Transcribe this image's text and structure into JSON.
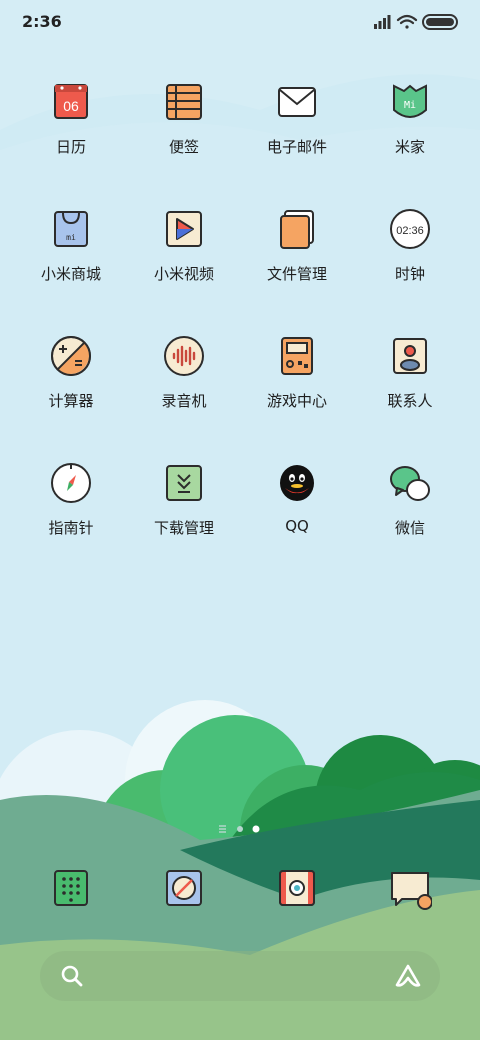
{
  "status": {
    "time": "2:36"
  },
  "apps": [
    {
      "label": "日历",
      "icon": "calendar-icon",
      "date": "06"
    },
    {
      "label": "便签",
      "icon": "notes-icon"
    },
    {
      "label": "电子邮件",
      "icon": "mail-icon"
    },
    {
      "label": "米家",
      "icon": "mijia-icon",
      "logo": "Mi"
    },
    {
      "label": "小米商城",
      "icon": "mi-store-icon",
      "logo": "mi"
    },
    {
      "label": "小米视频",
      "icon": "video-icon"
    },
    {
      "label": "文件管理",
      "icon": "file-manager-icon"
    },
    {
      "label": "时钟",
      "icon": "clock-icon",
      "time": "02:36"
    },
    {
      "label": "计算器",
      "icon": "calculator-icon"
    },
    {
      "label": "录音机",
      "icon": "recorder-icon"
    },
    {
      "label": "游戏中心",
      "icon": "game-center-icon"
    },
    {
      "label": "联系人",
      "icon": "contacts-icon"
    },
    {
      "label": "指南针",
      "icon": "compass-icon"
    },
    {
      "label": "下载管理",
      "icon": "download-icon"
    },
    {
      "label": "QQ",
      "icon": "qq-icon"
    },
    {
      "label": "微信",
      "icon": "wechat-icon"
    }
  ],
  "dock": [
    {
      "icon": "phone-dialer-icon"
    },
    {
      "icon": "browser-icon"
    },
    {
      "icon": "camera-icon"
    },
    {
      "icon": "messages-icon"
    }
  ],
  "page_indicator": {
    "pages": 3,
    "current": 3
  },
  "colors": {
    "sky": "#d3ecf5",
    "hill_dark": "#23795c",
    "hill_light": "#97c48a",
    "accent_orange": "#f5a462"
  }
}
